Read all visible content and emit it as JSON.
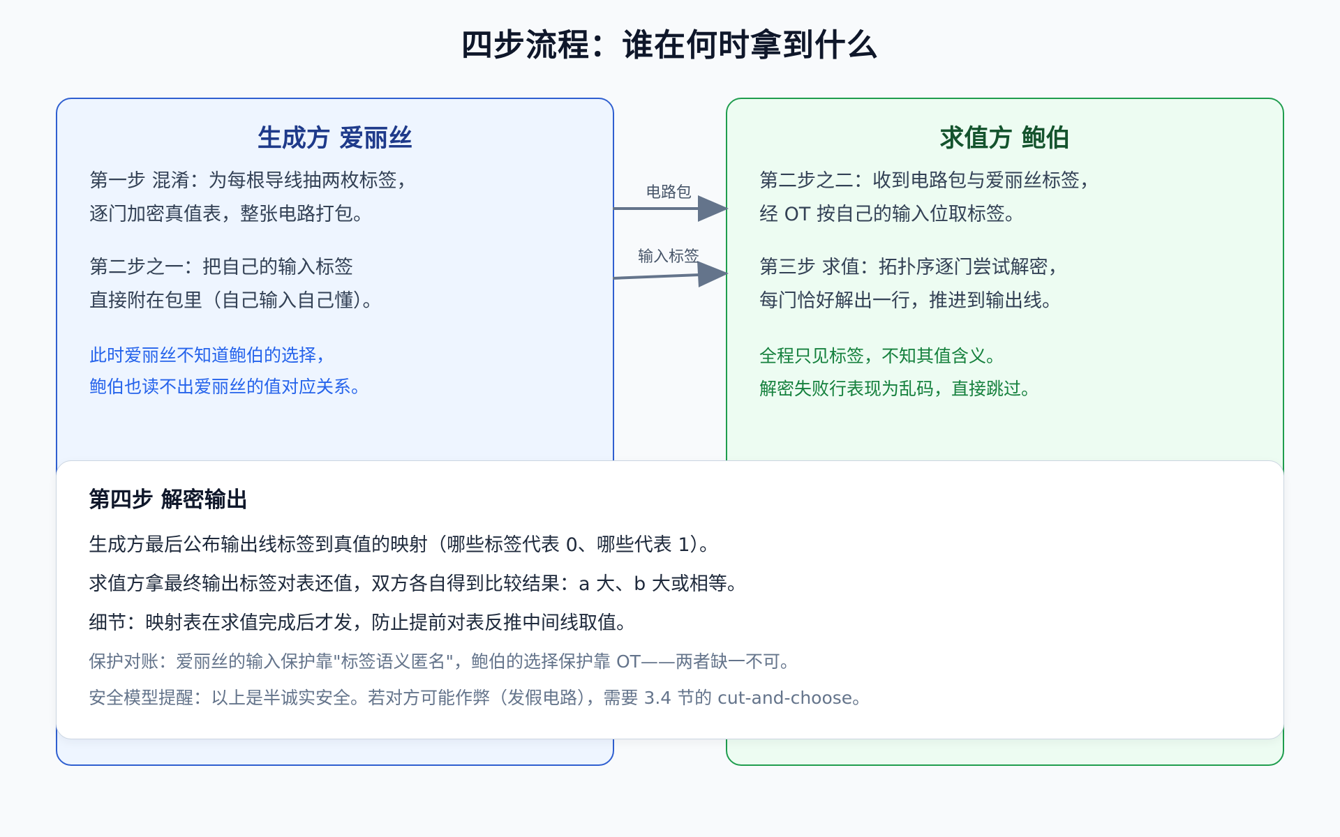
{
  "title": "四步流程：谁在何时拿到什么",
  "left_panel": {
    "title": "生成方 爱丽丝",
    "step1": [
      "第一步 混淆：为每根导线抽两枚标签，",
      "逐门加密真值表，整张电路打包。"
    ],
    "step2": [
      "第二步之一：把自己的输入标签",
      "直接附在包里（自己输入自己懂）。"
    ],
    "note": [
      "此时爱丽丝不知道鲍伯的选择，",
      "鲍伯也读不出爱丽丝的值对应关系。"
    ]
  },
  "right_panel": {
    "title": "求值方 鲍伯",
    "step2b": [
      "第二步之二：收到电路包与爱丽丝标签，",
      "经 OT 按自己的输入位取标签。"
    ],
    "step3": [
      "第三步 求值：拓扑序逐门尝试解密，",
      "每门恰好解出一行，推进到输出线。"
    ],
    "note": [
      "全程只见标签，不知其值含义。",
      "解密失败行表现为乱码，直接跳过。"
    ]
  },
  "connectors": {
    "circuit": "电路包",
    "input_labels": "输入标签"
  },
  "bottom": {
    "title": "第四步 解密输出",
    "lines": [
      "生成方最后公布输出线标签到真值的映射（哪些标签代表 0、哪些代表 1）。",
      "求值方拿最终输出标签对表还值，双方各自得到比较结果：a 大、b 大或相等。",
      "细节：映射表在求值完成后才发，防止提前对表反推中间线取值。"
    ],
    "notes": [
      "保护对账：爱丽丝的输入保护靠\"标签语义匿名\"，鲍伯的选择保护靠 OT——两者缺一不可。",
      "安全模型提醒：以上是半诚实安全。若对方可能作弊（发假电路），需要 3.4 节的 cut-and-choose。"
    ]
  },
  "colors": {
    "left_border": "#2f5fd0",
    "left_bg": "#eef5ff",
    "right_border": "#1f9d4e",
    "right_bg": "#edfcf2",
    "arrow": "#64748b"
  }
}
